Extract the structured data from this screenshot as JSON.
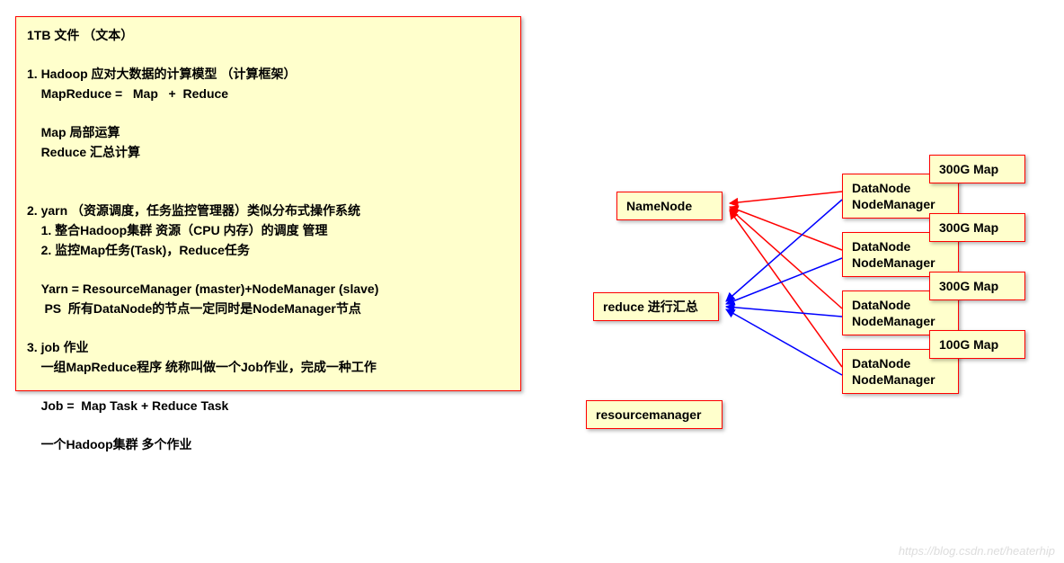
{
  "textbox": {
    "content": "1TB 文件 （文本）\n\n1. Hadoop 应对大数据的计算模型 （计算框架）\n    MapReduce =   Map   +  Reduce\n\n    Map 局部运算\n    Reduce 汇总计算\n\n\n2. yarn （资源调度，任务监控管理器）类似分布式操作系统\n    1. 整合Hadoop集群 资源（CPU 内存）的调度 管理\n    2. 监控Map任务(Task)，Reduce任务\n\n    Yarn = ResourceManager (master)+NodeManager (slave)\n     PS  所有DataNode的节点一定同时是NodeManager节点\n\n3. job 作业\n    一组MapReduce程序 统称叫做一个Job作业，完成一种工作\n\n    Job =  Map Task + Reduce Task\n\n    一个Hadoop集群 多个作业"
  },
  "nodes": {
    "namenode": "NameNode",
    "reduce": "reduce 进行汇总",
    "resourcemanager": "resourcemanager",
    "dn1_line1": "DataNode",
    "dn1_line2": "NodeManager",
    "dn2_line1": "DataNode",
    "dn2_line2": "NodeManager",
    "dn3_line1": "DataNode",
    "dn3_line2": "NodeManager",
    "dn4_line1": "DataNode",
    "dn4_line2": "NodeManager",
    "map1": "300G Map",
    "map2": "300G Map",
    "map3": "300G Map",
    "map4": "100G Map"
  },
  "watermark": "https://blog.csdn.net/heaterhip"
}
